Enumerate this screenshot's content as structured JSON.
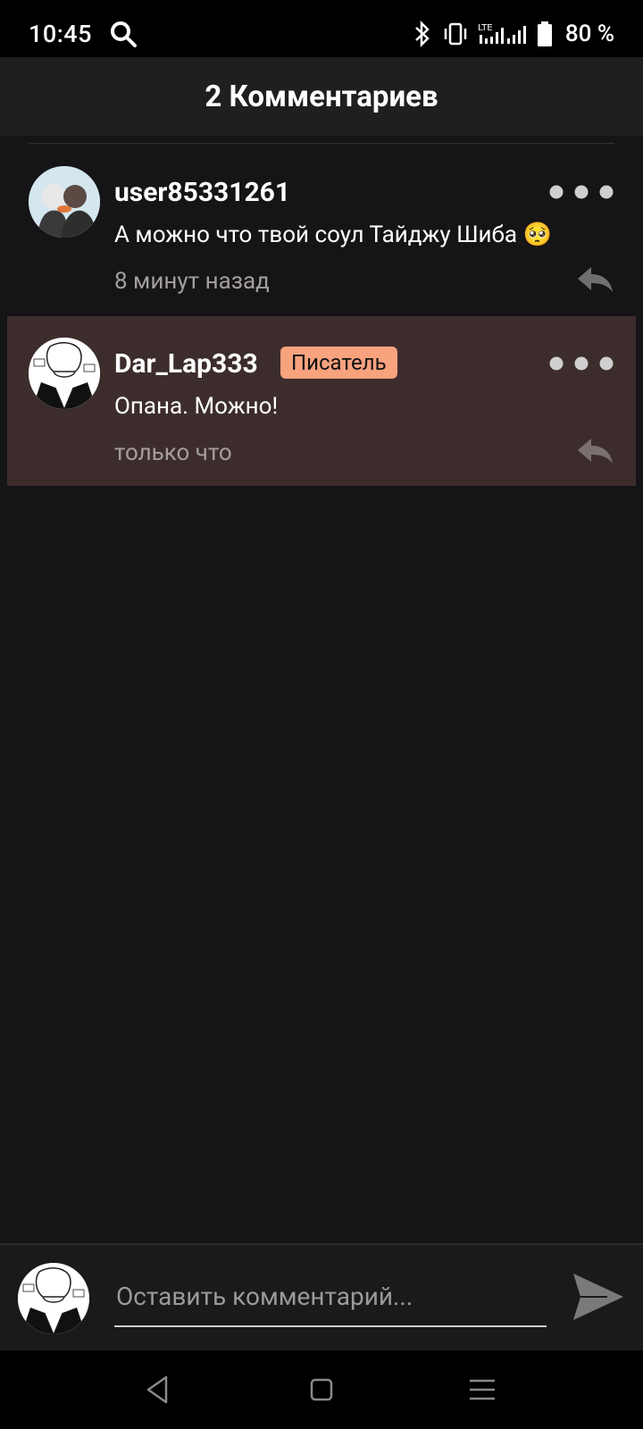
{
  "status": {
    "time": "10:45",
    "network": "LTE",
    "battery": "80 %"
  },
  "header": {
    "title": "2 Комментариев"
  },
  "comments": [
    {
      "username": "user85331261",
      "badge": "",
      "text": "А можно что твой соул Тайджу Шиба 🥺",
      "time": "8 минут назад"
    },
    {
      "username": "Dar_Lap333",
      "badge": "Писатель",
      "text": "Опана. Можно!",
      "time": "только что"
    }
  ],
  "composer": {
    "placeholder": "Оставить комментарий..."
  },
  "icons": {
    "status": [
      "search-icon",
      "bluetooth-icon",
      "vibrate-icon",
      "signal-icon",
      "battery-icon"
    ],
    "comment": [
      "more-options-icon",
      "reply-icon"
    ],
    "composer": [
      "send-icon"
    ],
    "nav": [
      "back-icon",
      "home-icon",
      "recents-icon"
    ]
  },
  "colors": {
    "badge": "#f9a27e",
    "highlight": "#3c2d2c",
    "background": "#151416"
  }
}
